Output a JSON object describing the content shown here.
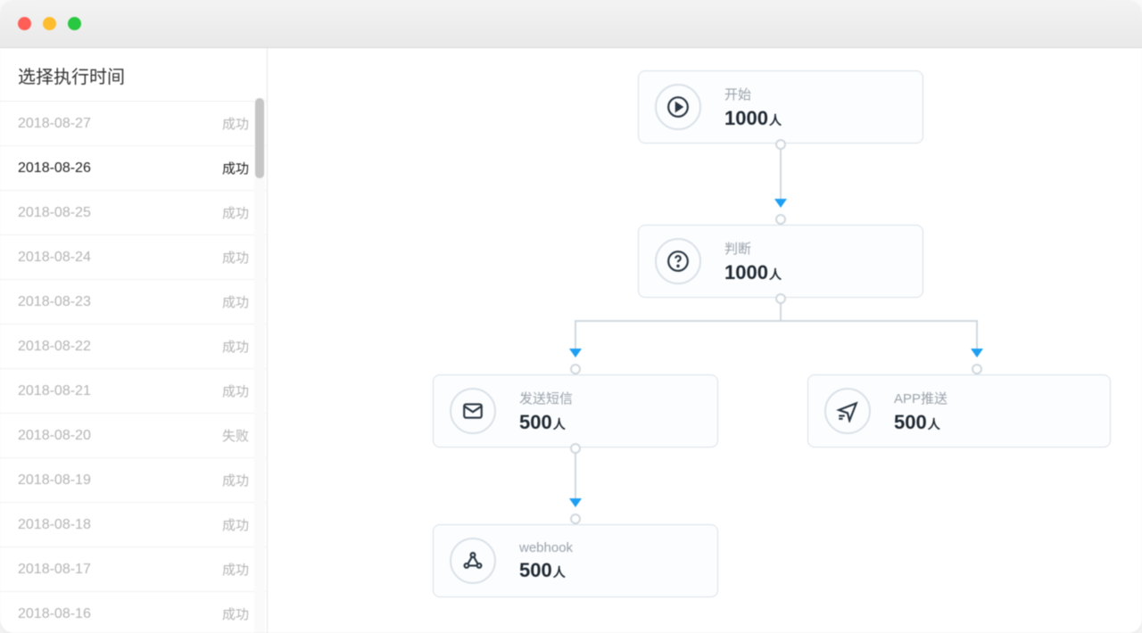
{
  "sidebar": {
    "title": "选择执行时间",
    "items": [
      {
        "date": "2018-08-27",
        "status": "成功"
      },
      {
        "date": "2018-08-26",
        "status": "成功"
      },
      {
        "date": "2018-08-25",
        "status": "成功"
      },
      {
        "date": "2018-08-24",
        "status": "成功"
      },
      {
        "date": "2018-08-23",
        "status": "成功"
      },
      {
        "date": "2018-08-22",
        "status": "成功"
      },
      {
        "date": "2018-08-21",
        "status": "成功"
      },
      {
        "date": "2018-08-20",
        "status": "失败"
      },
      {
        "date": "2018-08-19",
        "status": "成功"
      },
      {
        "date": "2018-08-18",
        "status": "成功"
      },
      {
        "date": "2018-08-17",
        "status": "成功"
      },
      {
        "date": "2018-08-16",
        "status": "成功"
      }
    ],
    "selected_index": 1
  },
  "nodes": {
    "start": {
      "label": "开始",
      "value": "1000",
      "unit": "人"
    },
    "decide": {
      "label": "判断",
      "value": "1000",
      "unit": "人"
    },
    "sms": {
      "label": "发送短信",
      "value": "500",
      "unit": "人"
    },
    "apppush": {
      "label": "APP推送",
      "value": "500",
      "unit": "人"
    },
    "webhook": {
      "label": "webhook",
      "value": "500",
      "unit": "人"
    }
  }
}
